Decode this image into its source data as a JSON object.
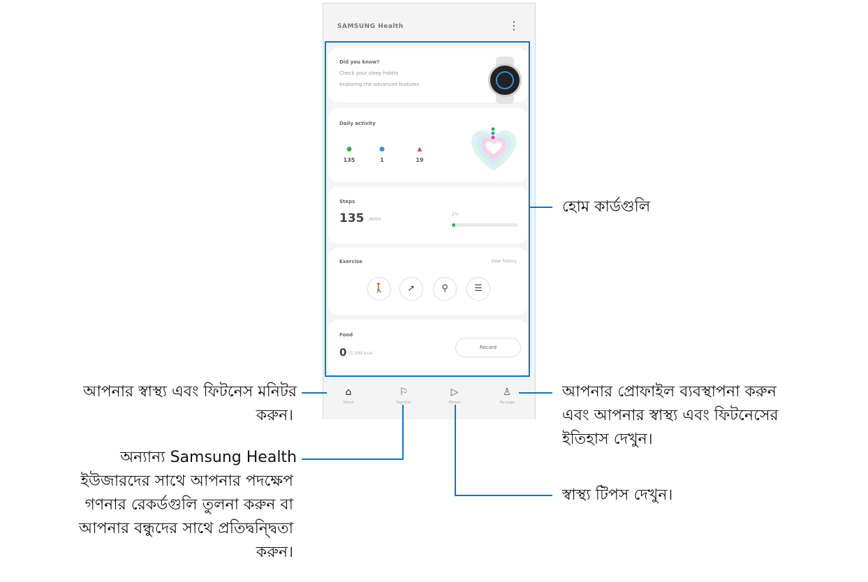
{
  "app": {
    "title": "SAMSUNG Health",
    "menu_icon": "more-vertical-icon"
  },
  "cards": {
    "did_you_know": {
      "title": "Did you know?",
      "line1": "Check your sleep habits",
      "line2": "exploring the advanced features."
    },
    "daily_activity": {
      "title": "Daily activity",
      "metrics": [
        {
          "icon": "steps-icon",
          "value": "135",
          "color": "#2fb34a"
        },
        {
          "icon": "active-time-icon",
          "value": "1",
          "color": "#3b8fd8"
        },
        {
          "icon": "calories-icon",
          "value": "19",
          "color": "#e8457a"
        }
      ]
    },
    "steps": {
      "title": "Steps",
      "value": "135",
      "unit": "/6000",
      "target_label": "2%",
      "progress": 0.02
    },
    "exercise": {
      "title": "Exercise",
      "view_history": "View history",
      "buttons": [
        "walking-icon",
        "running-icon",
        "cycling-icon",
        "list-icon"
      ]
    },
    "food": {
      "title": "Food",
      "value": "0",
      "unit": "/1,599 kcal",
      "record_label": "Record"
    }
  },
  "nav": [
    {
      "label": "Home",
      "icon": "home-icon"
    },
    {
      "label": "Together",
      "icon": "flag-icon"
    },
    {
      "label": "Fitness",
      "icon": "play-icon"
    },
    {
      "label": "My page",
      "icon": "person-icon"
    }
  ],
  "callouts": {
    "home_cards": "হোম কার্ডগুলি",
    "monitor_line1": "আপনার স্বাস্থ্য এবং ফিটনেস মনিটর",
    "monitor_line2": "করুন।",
    "together_line1": "অন্যান্য Samsung Health",
    "together_line2": "ইউজারদের সাথে আপনার পদক্ষেপ",
    "together_line3": "গণনার রেকর্ডগুলি তুলনা করুন বা",
    "together_line4": "আপনার বন্ধুদের সাথে প্রতিদ্বন্দ্বিতা",
    "together_line5": "করুন।",
    "profile_line1": "আপনার প্রোফাইল ব্যবস্থাপনা করুন",
    "profile_line2": "এবং আপনার স্বাস্থ্য এবং ফিটনেসের",
    "profile_line3": "ইতিহাস দেখুন।",
    "tips": "স্বাস্থ্য টিপস দেখুন।"
  },
  "colors": {
    "accent": "#1173c4",
    "steps": "#2fb34a"
  }
}
